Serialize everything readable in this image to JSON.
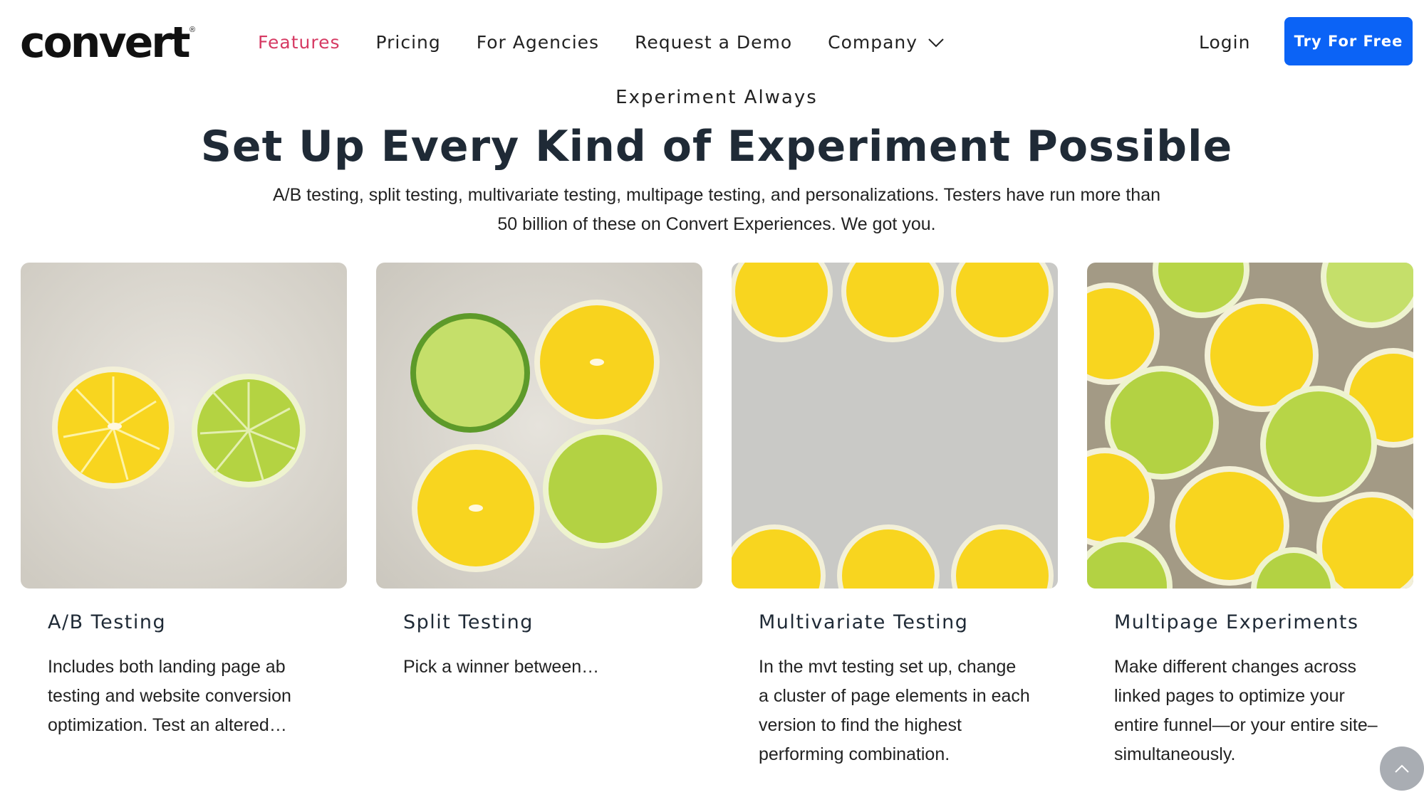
{
  "brand": {
    "name": "convert",
    "registered": "®"
  },
  "nav": {
    "links": [
      {
        "label": "Features",
        "active": true
      },
      {
        "label": "Pricing",
        "active": false
      },
      {
        "label": "For Agencies",
        "active": false
      },
      {
        "label": "Request a Demo",
        "active": false
      },
      {
        "label": "Company",
        "active": false,
        "dropdown": true
      }
    ],
    "login_label": "Login",
    "cta_label": "Try For Free"
  },
  "hero": {
    "eyebrow": "Experiment Always",
    "headline": "Set Up Every Kind of Experiment Possible",
    "subtext": "A/B testing, split testing, multivariate testing, multipage testing, and personalizations. Testers have run more than 50 billion of these on Convert Experiences. We got you."
  },
  "cards": [
    {
      "title": "A/B Testing",
      "description": "Includes both landing page ab testing and website conversion optimization. Test an altered…",
      "image": "two-citrus-slices"
    },
    {
      "title": "Split Testing",
      "description": "Pick a winner between…",
      "image": "four-citrus-slices"
    },
    {
      "title": "Multivariate Testing",
      "description": "In the mvt testing set up, change a cluster of page elements in each version to find the highest performing combination.",
      "image": "lemon-border-frame"
    },
    {
      "title": "Multipage Experiments",
      "description": "Make different changes across linked pages to optimize your entire funnel—or your entire site–simultaneously.",
      "image": "many-citrus-slices"
    }
  ],
  "colors": {
    "accent_active": "#d63a63",
    "cta": "#0b63f6",
    "lemon": "#f6d21c",
    "lime": "#a9cf3d"
  },
  "icons": {
    "scroll_top": "chevron-up-icon",
    "dropdown": "chevron-down-icon"
  }
}
